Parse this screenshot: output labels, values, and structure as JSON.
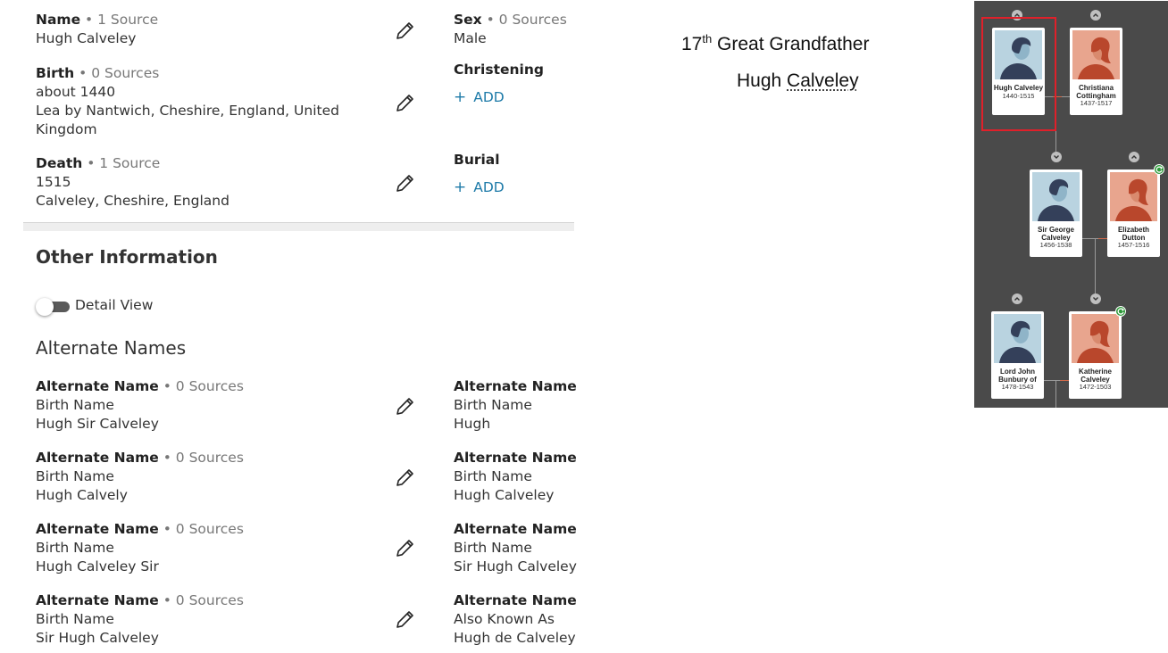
{
  "vitals": {
    "name": {
      "label": "Name",
      "sources": " • 1 Source",
      "value": "Hugh Calveley"
    },
    "sex": {
      "label": "Sex",
      "sources": " • 0 Sources",
      "value": "Male"
    },
    "birth": {
      "label": "Birth",
      "sources": " • 0 Sources",
      "date": "about 1440",
      "place": "Lea by Nantwich, Cheshire, England, United Kingdom"
    },
    "christening": {
      "label": "Christening",
      "add": "ADD"
    },
    "death": {
      "label": "Death",
      "sources": " • 1 Source",
      "date": "1515",
      "place": "Calveley, Cheshire, England"
    },
    "burial": {
      "label": "Burial",
      "add": "ADD"
    }
  },
  "other": {
    "title": "Other Information",
    "detail_view": "Detail View",
    "alternate_names_title": "Alternate Names"
  },
  "alternate_names": {
    "left": [
      {
        "label": "Alternate Name",
        "sources": " • 0 Sources",
        "type": "Birth Name",
        "value": "Hugh Sir Calveley"
      },
      {
        "label": "Alternate Name",
        "sources": " • 0 Sources",
        "type": "Birth Name",
        "value": "Hugh Calvely"
      },
      {
        "label": "Alternate Name",
        "sources": " • 0 Sources",
        "type": "Birth Name",
        "value": "Hugh Calveley Sir"
      },
      {
        "label": "Alternate Name",
        "sources": " • 0 Sources",
        "type": "Birth Name",
        "value": "Sir Hugh Calveley"
      }
    ],
    "right": [
      {
        "label": "Alternate Name",
        "type": "Birth Name",
        "value": "Hugh"
      },
      {
        "label": "Alternate Name",
        "type": "Birth Name",
        "value": "Hugh Calveley"
      },
      {
        "label": "Alternate Name",
        "type": "Birth Name",
        "value": "Sir Hugh Calveley"
      },
      {
        "label": "Alternate Name",
        "type": "Also Known As",
        "value": "Hugh de Calveley"
      }
    ]
  },
  "annotation": {
    "ordinal_num": "17",
    "ordinal_sup": "th",
    "relation": " Great Grandfather",
    "first_name": "Hugh ",
    "surname": "Calveley"
  },
  "tree": {
    "people": [
      {
        "name": "Hugh Calveley",
        "years": "1440-1515",
        "gender": "male"
      },
      {
        "name": "Christiana Cottingham",
        "years": "1437-1517",
        "gender": "female"
      },
      {
        "name": "Sir George Calveley",
        "years": "1456-1538",
        "gender": "male"
      },
      {
        "name": "Elizabeth Dutton",
        "years": "1457-1516",
        "gender": "female"
      },
      {
        "name": "Lord John Bunbury of",
        "years": "1478-1543",
        "gender": "male"
      },
      {
        "name": "Katherine Calveley",
        "years": "1472-1503",
        "gender": "female"
      }
    ],
    "colors": {
      "background": "#4a4a4a",
      "male_bg": "#b9d3e0",
      "female_bg": "#e8a58e",
      "selected": "#e0202a",
      "hint": "#2e9a3a"
    }
  },
  "icons": [
    "pencil-icon",
    "plus-icon",
    "chevron-up-icon",
    "chevron-down-icon",
    "record-hint-icon",
    "male-silhouette-icon",
    "female-silhouette-icon"
  ],
  "colors": {
    "link": "#1d7aa8",
    "text": "#333333",
    "muted": "#777777"
  }
}
